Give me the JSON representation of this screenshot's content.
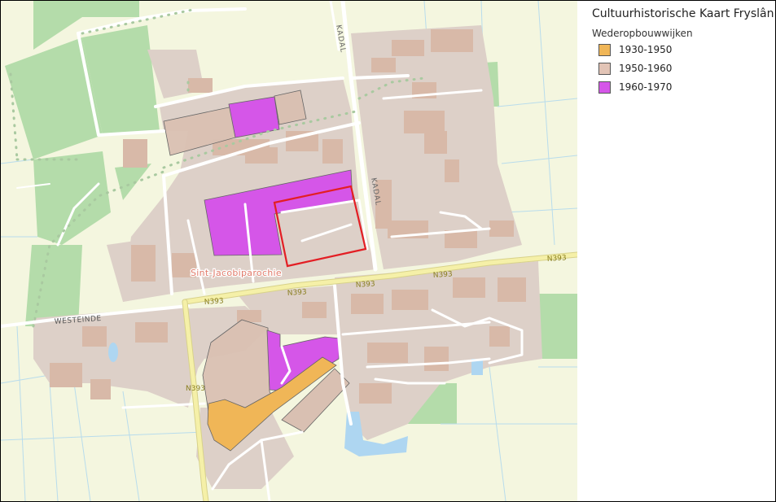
{
  "legend": {
    "title": "Cultuurhistorische Kaart Fryslân",
    "layer": "Wederopbouwwijken",
    "items": [
      {
        "label": "1930-1950",
        "color": "#f0b657"
      },
      {
        "label": "1950-1960",
        "color": "#e2c4b6"
      },
      {
        "label": "1960-1970",
        "color": "#d556e8"
      }
    ]
  },
  "map": {
    "place_label": "Sint-Jacobiparochie",
    "street_labels": {
      "kadal_north": "KADAL",
      "kadal_south": "KADAL",
      "westeinde": "WESTEINDE",
      "n393_east": "N393",
      "n393_mid": "N393",
      "n393_center": "N393",
      "n393_west": "N393",
      "n393_south": "N393"
    },
    "colors": {
      "background": "#f4f6df",
      "green": "#b4dcaa",
      "built": "#ddd0c8",
      "building": "#d8b9a8",
      "road": "#ffffff",
      "main_road": "#f5f0a8",
      "water": "#aed6f1",
      "selection": "#e31e24"
    }
  }
}
